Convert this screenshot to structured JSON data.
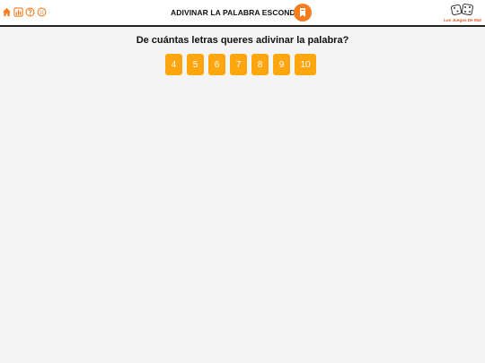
{
  "header": {
    "title": "ADIVINAR LA PALABRA ESCONDIDA",
    "icons": [
      "home-icon",
      "stats-icon",
      "help-icon",
      "fullscreen-icon"
    ],
    "logo_text": "Los Juegos De Mat"
  },
  "main": {
    "question": "De cuántas letras queres adivinar la palabra?",
    "choices": [
      "4",
      "5",
      "6",
      "7",
      "8",
      "9",
      "10"
    ]
  },
  "colors": {
    "accent": "#f57c1f",
    "button": "#ffa60f",
    "background": "#f4f4f4"
  }
}
